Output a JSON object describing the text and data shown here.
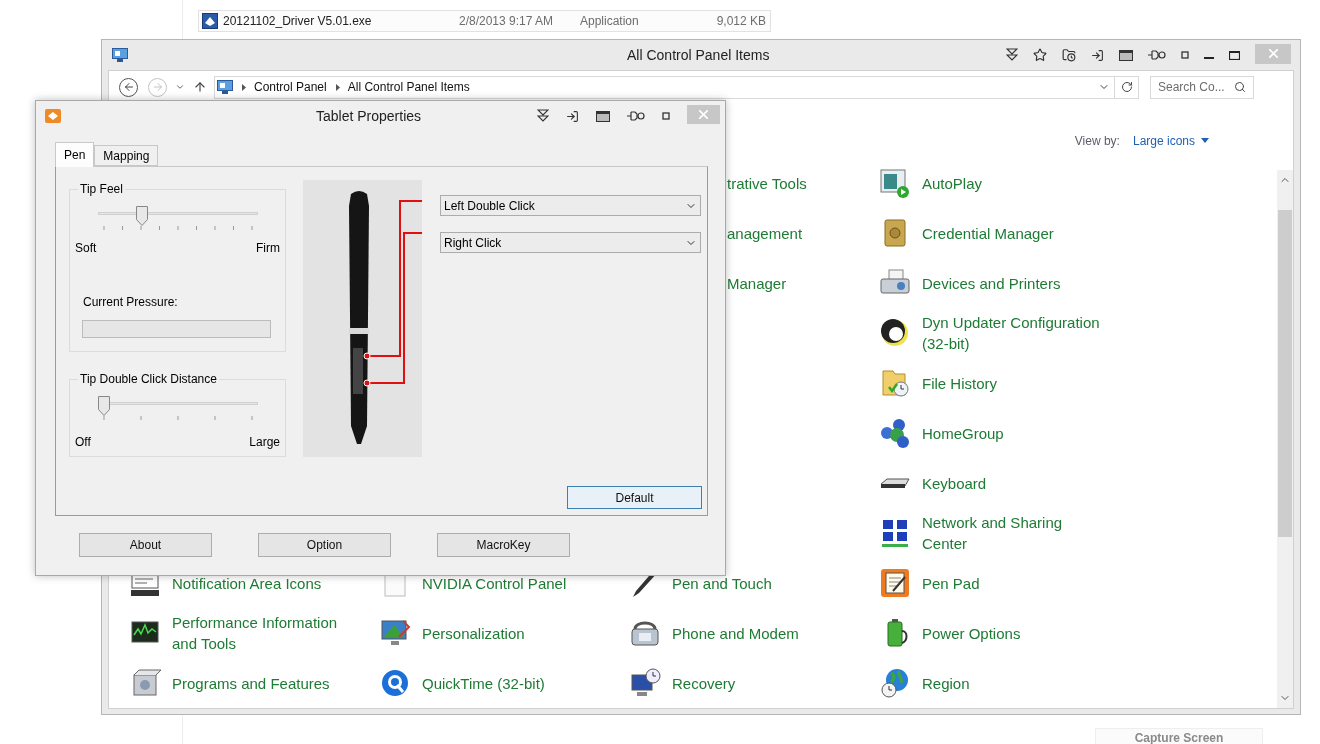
{
  "file_row": {
    "name": "20121102_Driver V5.01.exe",
    "date": "2/8/2013 9:17 AM",
    "type": "Application",
    "size": "9,012 KB"
  },
  "control_panel": {
    "title": "All Control Panel Items",
    "breadcrumb": [
      "Control Panel",
      "All Control Panel Items"
    ],
    "search": {
      "placeholder": "Search Co..."
    },
    "view_by": {
      "label": "View by:",
      "value": "Large icons"
    },
    "rows": [
      {
        "cells": [
          {
            "kind": "hidden"
          },
          {
            "kind": "hidden"
          },
          {
            "kind": "cut",
            "label": "trative Tools"
          },
          {
            "kind": "item",
            "label": "AutoPlay"
          }
        ]
      },
      {
        "cells": [
          {
            "kind": "hidden"
          },
          {
            "kind": "hidden"
          },
          {
            "kind": "cut",
            "label": "anagement"
          },
          {
            "kind": "item",
            "label": "Credential Manager"
          }
        ]
      },
      {
        "cells": [
          {
            "kind": "hidden"
          },
          {
            "kind": "hidden"
          },
          {
            "kind": "cut",
            "label": "Manager"
          },
          {
            "kind": "item",
            "label": "Devices and Printers"
          }
        ]
      },
      {
        "cells": [
          {
            "kind": "hidden"
          },
          {
            "kind": "hidden"
          },
          {
            "kind": "hidden"
          },
          {
            "kind": "item",
            "label": "Dyn Updater Configuration (32-bit)"
          }
        ]
      },
      {
        "cells": [
          {
            "kind": "hidden"
          },
          {
            "kind": "hidden"
          },
          {
            "kind": "hidden"
          },
          {
            "kind": "item",
            "label": "File History"
          }
        ]
      },
      {
        "cells": [
          {
            "kind": "hidden"
          },
          {
            "kind": "hidden"
          },
          {
            "kind": "hidden"
          },
          {
            "kind": "item",
            "label": "HomeGroup"
          }
        ]
      },
      {
        "cells": [
          {
            "kind": "hidden"
          },
          {
            "kind": "hidden"
          },
          {
            "kind": "hidden"
          },
          {
            "kind": "item",
            "label": "Keyboard"
          }
        ]
      },
      {
        "cells": [
          {
            "kind": "hidden"
          },
          {
            "kind": "hidden"
          },
          {
            "kind": "hidden"
          },
          {
            "kind": "item",
            "label": "Network and Sharing Center"
          }
        ]
      },
      {
        "cells": [
          {
            "kind": "item",
            "label": "Notification Area Icons"
          },
          {
            "kind": "item",
            "label": "NVIDIA Control Panel"
          },
          {
            "kind": "item",
            "label": "Pen and Touch"
          },
          {
            "kind": "item",
            "label": "Pen Pad"
          }
        ]
      },
      {
        "cells": [
          {
            "kind": "item",
            "label": "Performance Information and Tools"
          },
          {
            "kind": "item",
            "label": "Personalization"
          },
          {
            "kind": "item",
            "label": "Phone and Modem"
          },
          {
            "kind": "item",
            "label": "Power Options"
          }
        ]
      },
      {
        "cells": [
          {
            "kind": "item",
            "label": "Programs and Features"
          },
          {
            "kind": "item",
            "label": "QuickTime (32-bit)"
          },
          {
            "kind": "item",
            "label": "Recovery"
          },
          {
            "kind": "item",
            "label": "Region"
          }
        ]
      }
    ]
  },
  "tablet": {
    "title": "Tablet Properties",
    "tabs": [
      {
        "label": "Pen",
        "selected": true
      },
      {
        "label": "Mapping",
        "selected": false
      }
    ],
    "tip_feel": {
      "title": "Tip Feel",
      "level": 0.26,
      "min_label": "Soft",
      "max_label": "Firm",
      "pressure": {
        "label": "Current Pressure:"
      }
    },
    "double_click": {
      "title": "Tip Double Click Distance",
      "level": 0,
      "min_label": "Off",
      "max_label": "Large"
    },
    "pen_buttons": [
      {
        "value": "Left Double Click"
      },
      {
        "value": "Right Click"
      }
    ],
    "default_button": {
      "label": "Default",
      "focused": true
    },
    "footer_buttons": [
      {
        "label": "About",
        "focused": false
      },
      {
        "label": "Option",
        "focused": false
      },
      {
        "label": "MacroKey",
        "focused": false
      }
    ]
  },
  "capture_button": {
    "label": "Capture Screen"
  }
}
